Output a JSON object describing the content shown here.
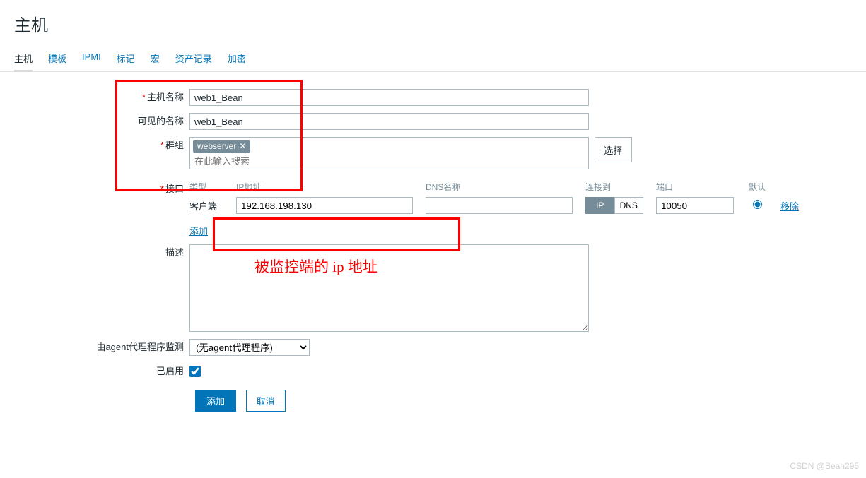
{
  "page_title": "主机",
  "tabs": [
    "主机",
    "模板",
    "IPMI",
    "标记",
    "宏",
    "资产记录",
    "加密"
  ],
  "active_tab": 0,
  "form": {
    "hostname_label": "主机名称",
    "hostname_value": "web1_Bean",
    "visible_label": "可见的名称",
    "visible_value": "web1_Bean",
    "groups_label": "群组",
    "groups_tag": "webserver",
    "groups_placeholder": "在此输入搜索",
    "groups_select_btn": "选择",
    "iface_label": "接口",
    "iface_headers": {
      "type": "类型",
      "ip": "IP地址",
      "dns": "DNS名称",
      "connect": "连接到",
      "port": "端口",
      "default": "默认"
    },
    "iface_row": {
      "type": "客户端",
      "ip": "192.168.198.130",
      "dns": "",
      "port": "10050",
      "conn": "IP"
    },
    "conn_options": {
      "ip": "IP",
      "dns": "DNS"
    },
    "remove_link": "移除",
    "add_link": "添加",
    "desc_label": "描述",
    "desc_value": "",
    "proxy_label": "由agent代理程序监测",
    "proxy_value": "(无agent代理程序)",
    "enabled_label": "已启用",
    "enabled_checked": true,
    "submit_btn": "添加",
    "cancel_btn": "取消"
  },
  "annotation": "被监控端的 ip 地址",
  "watermark": "CSDN @Bean295"
}
